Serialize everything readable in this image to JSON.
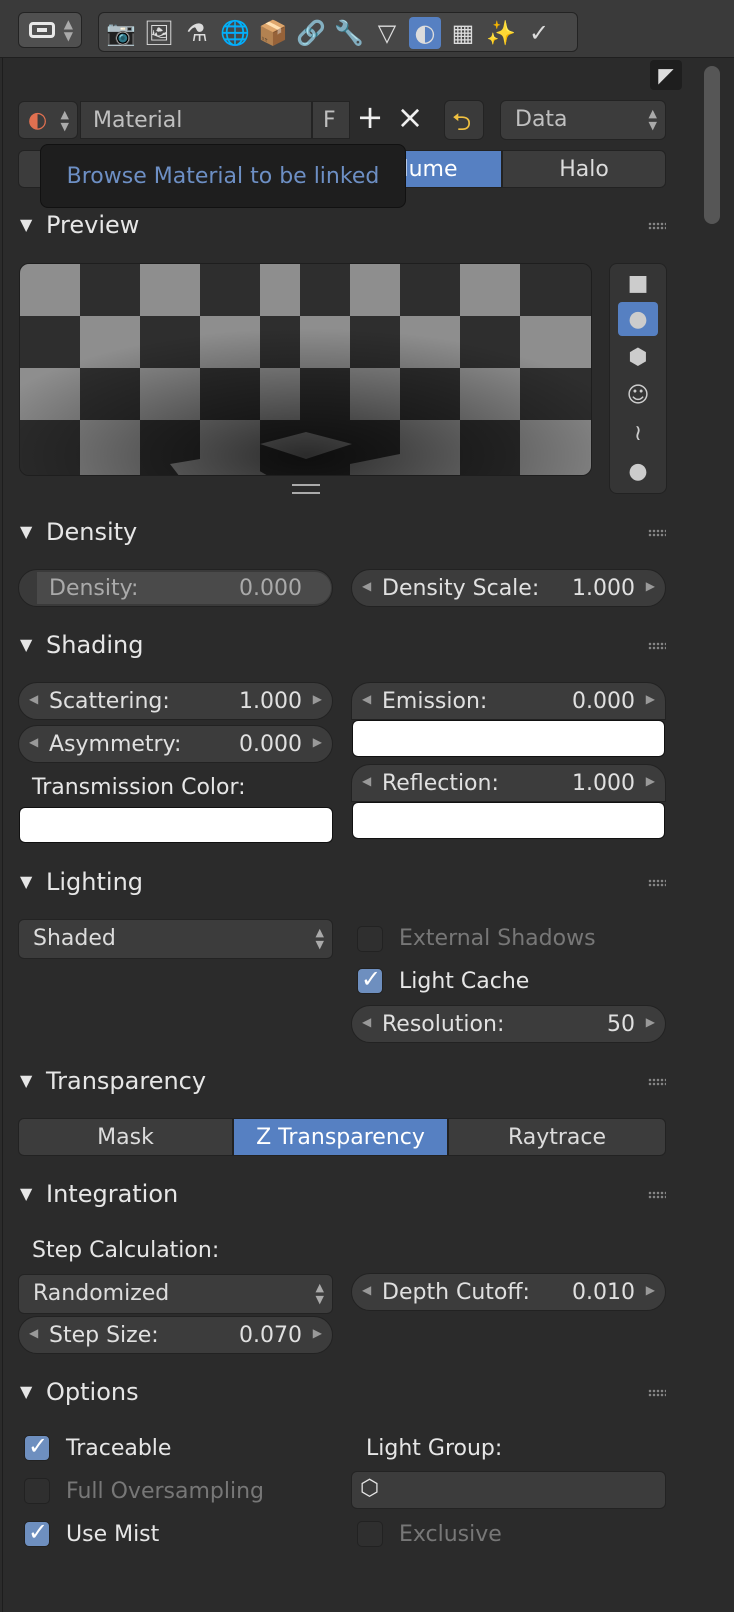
{
  "material": {
    "name_field_value": "Material",
    "fake_user_label": "F",
    "new_label": "+",
    "unlink_label": "×",
    "link_mode_value": "Data",
    "tooltip_text": "Browse Material to be linked"
  },
  "type_tabs": [
    {
      "label": "lume",
      "active": true
    },
    {
      "label": "Halo",
      "active": false
    }
  ],
  "sections": {
    "preview": "Preview",
    "density": "Density",
    "shading": "Shading",
    "lighting": "Lighting",
    "transparency": "Transparency",
    "integration": "Integration",
    "options": "Options"
  },
  "density": {
    "density_label": "Density:",
    "density_value": "0.000",
    "scale_label": "Density Scale:",
    "scale_value": "1.000"
  },
  "shading": {
    "scattering_label": "Scattering:",
    "scattering_value": "1.000",
    "asymmetry_label": "Asymmetry:",
    "asymmetry_value": "0.000",
    "transmission_label": "Transmission Color:",
    "emission_label": "Emission:",
    "emission_value": "0.000",
    "reflection_label": "Reflection:",
    "reflection_value": "1.000",
    "swatch_color": "#ffffff"
  },
  "lighting": {
    "mode_value": "Shaded",
    "external_shadows_label": "External Shadows",
    "external_shadows_checked": false,
    "light_cache_label": "Light Cache",
    "light_cache_checked": true,
    "resolution_label": "Resolution:",
    "resolution_value": "50"
  },
  "transparency": {
    "options": [
      "Mask",
      "Z Transparency",
      "Raytrace"
    ],
    "active_index": 1
  },
  "integration": {
    "step_calc_label": "Step Calculation:",
    "step_calc_value": "Randomized",
    "depth_cutoff_label": "Depth Cutoff:",
    "depth_cutoff_value": "0.010",
    "step_size_label": "Step Size:",
    "step_size_value": "0.070"
  },
  "options": {
    "traceable_label": "Traceable",
    "traceable_checked": true,
    "full_oversampling_label": "Full Oversampling",
    "full_oversampling_checked": false,
    "use_mist_label": "Use Mist",
    "use_mist_checked": true,
    "light_group_label": "Light Group:",
    "exclusive_label": "Exclusive",
    "exclusive_checked": false
  },
  "colors": {
    "accent": "#5680c2",
    "tooltip_text": "#6d8fc4",
    "background": "#2b2b2b"
  },
  "icons": {
    "context_tabs": [
      "render-icon",
      "render-layers-icon",
      "scene-icon",
      "world-icon",
      "object-icon",
      "constraints-icon",
      "modifiers-icon",
      "data-icon",
      "material-icon",
      "texture-icon",
      "particles-icon",
      "physics-icon"
    ],
    "preview_types": [
      "plane-icon",
      "sphere-icon",
      "cube-icon",
      "monkey-icon",
      "hair-icon",
      "sphere-sky-icon"
    ]
  }
}
